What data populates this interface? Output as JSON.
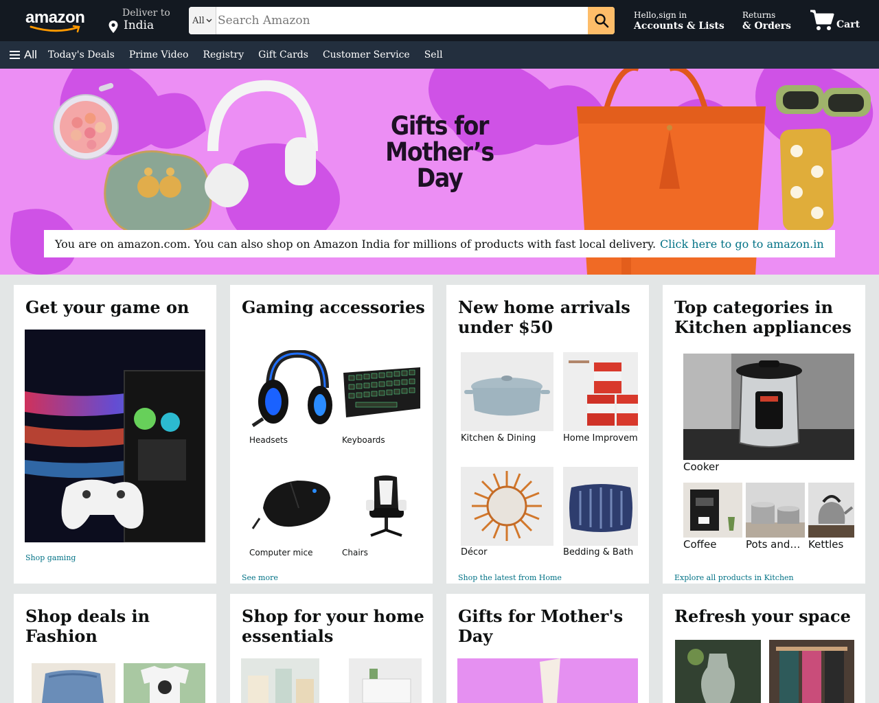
{
  "header": {
    "logo_text": "amazon",
    "deliver_label": "Deliver to",
    "deliver_location": "India",
    "search_category": "All",
    "search_placeholder": "Search Amazon",
    "account_greeting": "Hello,sign in",
    "account_label": "Accounts & Lists",
    "returns_label": "Returns",
    "orders_label": "& Orders",
    "cart_label": "Cart"
  },
  "nav": {
    "all_label": "All",
    "items": [
      "Today's Deals",
      "Prime Video",
      "Registry",
      "Gift Cards",
      "Customer Service",
      "Sell"
    ]
  },
  "hero": {
    "title_line1": "Gifts for",
    "title_line2": "Mother’s Day",
    "notice_text": "You are on amazon.com. You can also shop on Amazon India for millions of products with fast local delivery.",
    "notice_link": "Click here to go to amazon.in"
  },
  "cards": {
    "game": {
      "title": "Get your game on",
      "link": "Shop gaming"
    },
    "gaming_accessories": {
      "title": "Gaming accessories",
      "tiles": [
        "Headsets",
        "Keyboards",
        "Computer mice",
        "Chairs"
      ],
      "link": "See more"
    },
    "home_arrivals": {
      "title": "New home arrivals under $50",
      "tiles": [
        "Kitchen & Dining",
        "Home Improvement",
        "Décor",
        "Bedding & Bath"
      ],
      "link": "Shop the latest from Home"
    },
    "kitchen": {
      "title": "Top categories in Kitchen appliances",
      "main_tile": "Cooker",
      "tiles": [
        "Coffee",
        "Pots and…",
        "Kettles"
      ],
      "link": "Explore all products in Kitchen"
    },
    "fashion": {
      "title": "Shop deals in Fashion"
    },
    "home_essentials": {
      "title": "Shop for your home essentials"
    },
    "mothers_day": {
      "title": "Gifts for Mother's Day"
    },
    "refresh": {
      "title": "Refresh your space"
    }
  },
  "colors": {
    "header_bg": "#131921",
    "nav_bg": "#232f3e",
    "search_button": "#febd69",
    "hero_bg": "#ec8ef4",
    "link": "#007185",
    "page_bg": "#e3e6e6"
  }
}
